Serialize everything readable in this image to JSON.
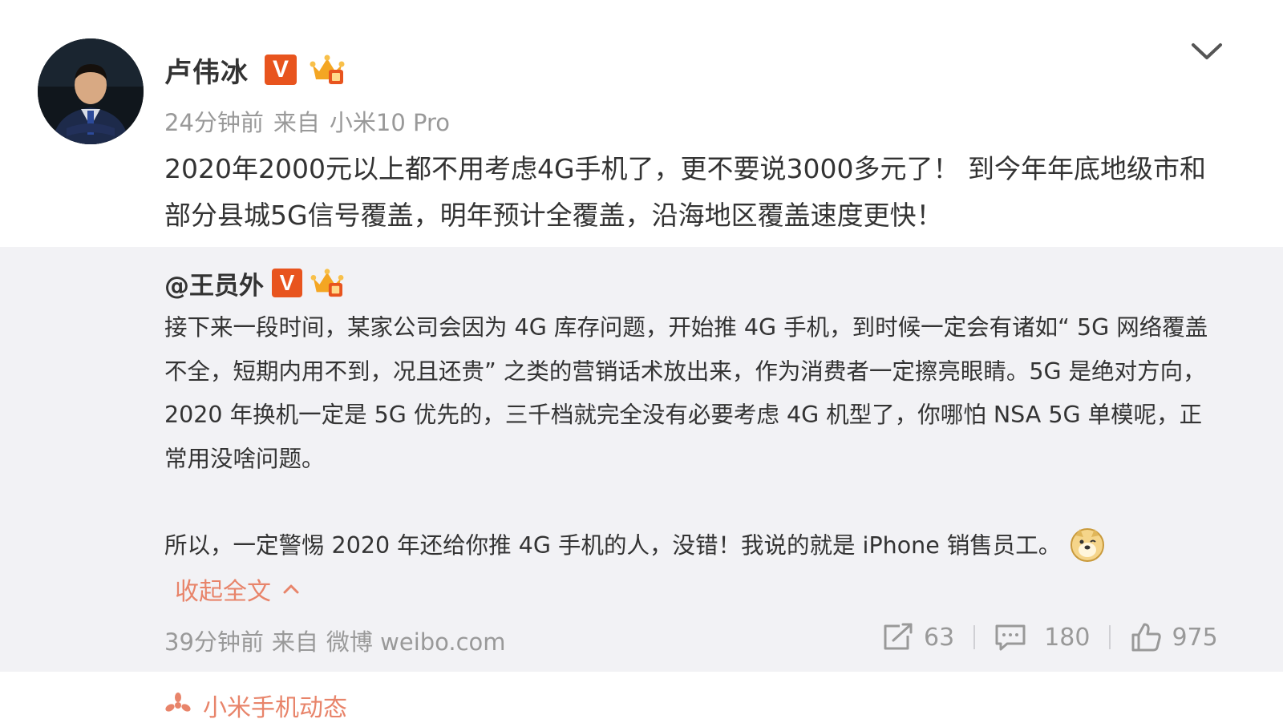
{
  "post": {
    "author": "卢伟冰",
    "verified_badge": "V",
    "time": "24分钟前",
    "source_prefix": "来自",
    "source": "小米10 Pro",
    "text": "2020年2000元以上都不用考虑4G手机了，更不要说3000多元了！ 到今年年底地级市和部分县城5G信号覆盖，明年预计全覆盖，沿海地区覆盖速度更快！"
  },
  "repost": {
    "author": "@王员外",
    "verified_badge": "V",
    "paragraph1": "接下来一段时间，某家公司会因为 4G 库存问题，开始推 4G 手机，到时候一定会有诸如“ 5G 网络覆盖不全，短期内用不到，况且还贵” 之类的营销话术放出来，作为消费者一定擦亮眼睛。5G 是绝对方向，2020 年换机一定是 5G 优先的，三千档就完全没有必要考虑 4G 机型了，你哪怕 NSA 5G 单模呢，正常用没啥问题。",
    "paragraph2": "所以，一定警惕 2020 年还给你推 4G 手机的人，没错！我说的就是 iPhone 销售员工。",
    "collapse_label": "收起全文",
    "time": "39分钟前",
    "source_prefix": "来自",
    "source": "微博 weibo.com",
    "reposts": "63",
    "comments": "180",
    "likes": "975"
  },
  "next_section": {
    "label": "小米手机动态"
  },
  "icons": {
    "menu": "chevron-down-icon",
    "member": "crown-member-icon",
    "emoji": "doge-emoji-icon",
    "repost": "repost-icon",
    "comment": "comment-icon",
    "like": "thumbs-up-icon",
    "section": "fan-icon"
  },
  "colors": {
    "verified": "#e8541e",
    "link": "#e8846a",
    "meta_text": "#999999",
    "card_bg": "#f2f2f5"
  }
}
